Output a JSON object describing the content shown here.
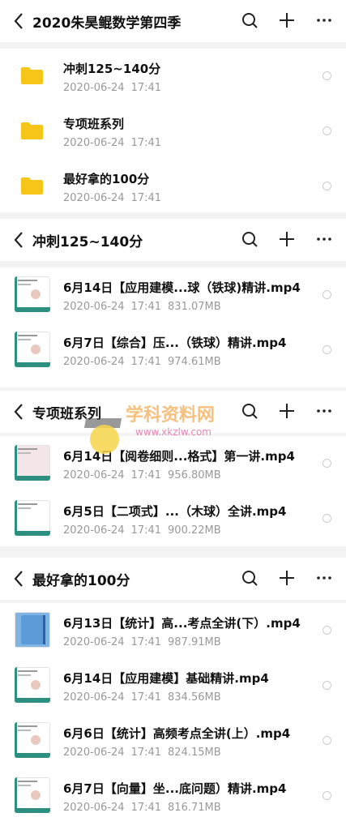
{
  "panels": [
    {
      "title": "2020朱昊鲲数学第四季",
      "items": [
        {
          "name": "冲刺125~140分",
          "date": "2020-06-24",
          "time": "17:41",
          "size": ""
        },
        {
          "name": "专项班系列",
          "date": "2020-06-24",
          "time": "17:41",
          "size": ""
        },
        {
          "name": "最好拿的100分",
          "date": "2020-06-24",
          "time": "17:41",
          "size": ""
        }
      ]
    },
    {
      "title": "冲刺125~140分",
      "items": [
        {
          "name": "6月14日【应用建模...球（铁球)精讲.mp4",
          "date": "2020-06-24",
          "time": "17:41",
          "size": "831.07MB"
        },
        {
          "name": "6月7日【综合】压...（铁球）精讲.mp4",
          "date": "2020-06-24",
          "time": "17:41",
          "size": "974.61MB"
        }
      ]
    },
    {
      "title": "专项班系列",
      "items": [
        {
          "name": "6月14日【阅卷细则...格式】第一讲.mp4",
          "date": "2020-06-24",
          "time": "17:41",
          "size": "956.80MB"
        },
        {
          "name": "6月5日【二项式】...（木球）全讲.mp4",
          "date": "2020-06-24",
          "time": "17:41",
          "size": "900.22MB"
        }
      ]
    },
    {
      "title": "最好拿的100分",
      "items": [
        {
          "name": "6月13日【统计】高...考点全讲(下）.mp4",
          "date": "2020-06-24",
          "time": "17:41",
          "size": "987.91MB"
        },
        {
          "name": "6月14日【应用建模】基础精讲.mp4",
          "date": "2020-06-24",
          "time": "17:41",
          "size": "834.56MB"
        },
        {
          "name": "6月6日【统计】高频考点全讲(上）.mp4",
          "date": "2020-06-24",
          "time": "17:41",
          "size": "824.15MB"
        },
        {
          "name": "6月7日【向量】坐...底问题）精讲.mp4",
          "date": "2020-06-24",
          "time": "17:41",
          "size": "816.71MB"
        }
      ]
    }
  ],
  "icons": {
    "back": "chevron-left-icon",
    "search": "search-icon",
    "add": "plus-icon",
    "more": "more-icon",
    "folder": "folder-icon"
  },
  "colors": {
    "folder": "#f5c518",
    "accent": "#2c8f80"
  },
  "watermark": {
    "text": "学科资料网",
    "url": "www.xkzlw.com"
  }
}
